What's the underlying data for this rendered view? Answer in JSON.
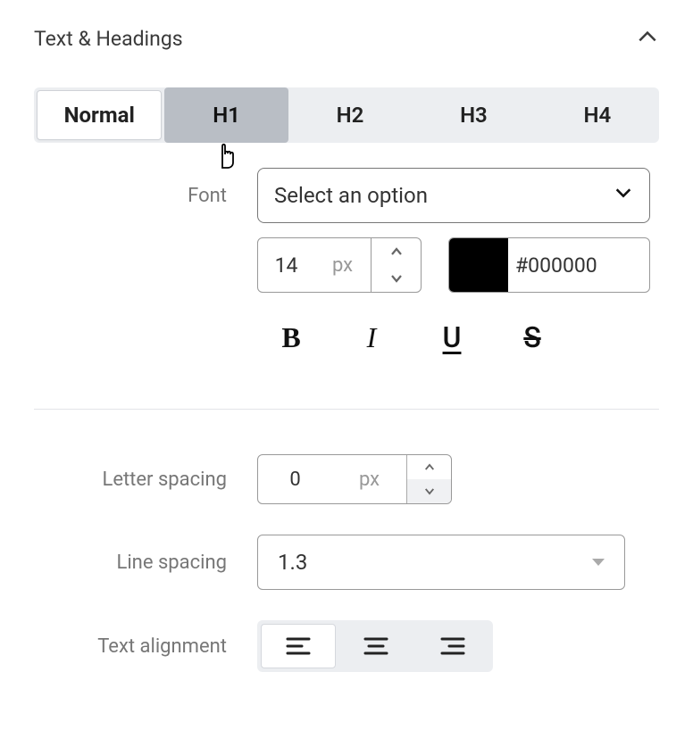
{
  "section": {
    "title": "Text & Headings"
  },
  "tabs": {
    "items": [
      {
        "label": "Normal",
        "state": "active"
      },
      {
        "label": "H1",
        "state": "hover"
      },
      {
        "label": "H2",
        "state": ""
      },
      {
        "label": "H3",
        "state": ""
      },
      {
        "label": "H4",
        "state": ""
      }
    ]
  },
  "font": {
    "label": "Font",
    "select_placeholder": "Select an option",
    "size_value": "14",
    "size_unit": "px",
    "color_hex": "#000000",
    "color_value": "#000000"
  },
  "style_buttons": {
    "bold": "B",
    "italic": "I",
    "underline": "U",
    "strike": "S"
  },
  "letter_spacing": {
    "label": "Letter spacing",
    "value": "0",
    "unit": "px"
  },
  "line_spacing": {
    "label": "Line spacing",
    "value": "1.3"
  },
  "text_alignment": {
    "label": "Text alignment",
    "active": "left"
  }
}
